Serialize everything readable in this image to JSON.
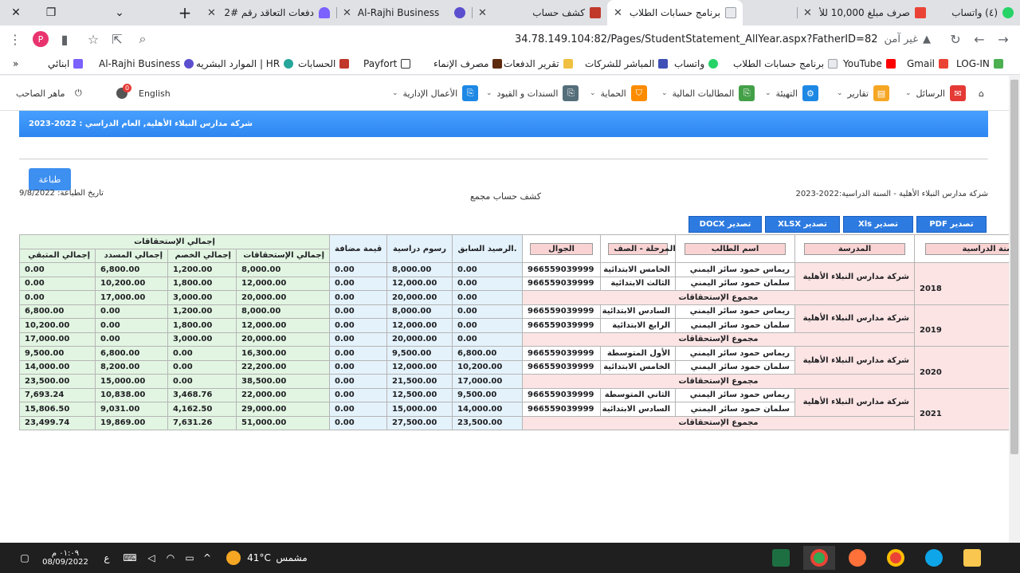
{
  "browser": {
    "tabs": [
      {
        "title": "(٤) واتساب",
        "color": "#25d366"
      },
      {
        "title": "صرف مبلغ 10,000 للأسـ",
        "color": "#ea4335"
      },
      {
        "title": "برنامج حسابات الطلاب",
        "color": "#ffffff"
      },
      {
        "title": "كشف حساب",
        "color": "#c0392b"
      },
      {
        "title": "Al-Rajhi Business",
        "color": "#5b4fcf"
      },
      {
        "title": "دفعات التعاقد رقم #2",
        "color": "#7b61ff"
      }
    ],
    "new_tab": "+",
    "url": "34.78.149.104:82/Pages/StudentStatement_AllYear.aspx?FatherID=82",
    "security_text": "غير آمن",
    "bookmarks": [
      "LOG-IN",
      "Gmail",
      "YouTube",
      "برنامج حسابات الطلاب",
      "واتساب",
      "المباشر للشركات",
      "تقرير الدفعات",
      "مصرف الإنماء",
      "Payfort",
      "الحسابات",
      "الموارد البشريه | HR",
      "Al-Rajhi Business",
      "ابنائي"
    ],
    "bookmarks_more": "»"
  },
  "nav": {
    "items": [
      "الرسائل",
      "تقارير",
      "التهيئة",
      "المطالبات المالية",
      "الحماية",
      "السندات و القيود",
      "الأعمال الإدارية"
    ],
    "language": "English",
    "user": "ماهر الصاحب",
    "notif_count": "0",
    "icon_colors": [
      "#e53935",
      "#f5a623",
      "#1e88e5",
      "#43a047",
      "#fb8c00",
      "#546e7a",
      "#1e88e5"
    ]
  },
  "page": {
    "banner": "شركة مدارس النبلاء الأهلية, العام الدراسي : 2022-2023",
    "print_button": "طباعة",
    "school_year": "شركة مدارس النبلاء الأهلية - السنة الدراسية:2022-2023",
    "statement_title": "كشف حساب مجمع",
    "print_date": "تاريخ الطباعة: 9/8/2022",
    "export_buttons": [
      "تصدير PDF",
      "تصدير Xls",
      "تصدير XLSX",
      "تصدير DOCX"
    ]
  },
  "table": {
    "headers": {
      "year": "السنة الدراسية",
      "school": "المدرسة",
      "student": "اسم الطالب",
      "stage": "المرحلة - الصف",
      "mobile": "الجوال",
      "prev_balance": "الرصيد السابق.",
      "fees": "رسوم دراسية",
      "added": "قيمة مضافة",
      "group": "إجمالي الإستحقاقات",
      "total_due": "إجمالي الإستحقاقات",
      "total_discount": "إجمالي الخصم",
      "total_paid": "إجمالي المسدد",
      "total_remaining": "إجمالي المتبقي"
    },
    "sum_label": "مجموع الإستحقاقات",
    "years": [
      {
        "year": "2018",
        "school": "شركة مدارس النبلاء الأهلية",
        "rows": [
          {
            "student": "ريماس حمود سائر اليمني",
            "stage": "الخامس الابتدائية",
            "mobile": "966559039999",
            "prev": "0.00",
            "fees": "8,000.00",
            "added": "0.00",
            "due": "8,000.00",
            "disc": "1,200.00",
            "paid": "6,800.00",
            "rem": "0.00"
          },
          {
            "student": "سلمان حمود سائر اليمني",
            "stage": "الثالث الابتدائية",
            "mobile": "966559039999",
            "prev": "0.00",
            "fees": "12,000.00",
            "added": "0.00",
            "due": "12,000.00",
            "disc": "1,800.00",
            "paid": "10,200.00",
            "rem": "0.00"
          }
        ],
        "sum": {
          "prev": "0.00",
          "fees": "20,000.00",
          "added": "0.00",
          "due": "20,000.00",
          "disc": "3,000.00",
          "paid": "17,000.00",
          "rem": "0.00"
        }
      },
      {
        "year": "2019",
        "school": "شركة مدارس النبلاء الأهلية",
        "rows": [
          {
            "student": "ريماس حمود سائر اليمني",
            "stage": "السادس الابتدائية",
            "mobile": "966559039999",
            "prev": "0.00",
            "fees": "8,000.00",
            "added": "0.00",
            "due": "8,000.00",
            "disc": "1,200.00",
            "paid": "0.00",
            "rem": "6,800.00"
          },
          {
            "student": "سلمان حمود سائر اليمني",
            "stage": "الرابع الابتدائية",
            "mobile": "966559039999",
            "prev": "0.00",
            "fees": "12,000.00",
            "added": "0.00",
            "due": "12,000.00",
            "disc": "1,800.00",
            "paid": "0.00",
            "rem": "10,200.00"
          }
        ],
        "sum": {
          "prev": "0.00",
          "fees": "20,000.00",
          "added": "0.00",
          "due": "20,000.00",
          "disc": "3,000.00",
          "paid": "0.00",
          "rem": "17,000.00"
        }
      },
      {
        "year": "2020",
        "school": "شركة مدارس النبلاء الأهلية",
        "rows": [
          {
            "student": "ريماس حمود سائر اليمني",
            "stage": "الأول المتوسطة",
            "mobile": "966559039999",
            "prev": "6,800.00",
            "fees": "9,500.00",
            "added": "0.00",
            "due": "16,300.00",
            "disc": "0.00",
            "paid": "6,800.00",
            "rem": "9,500.00"
          },
          {
            "student": "سلمان حمود سائر اليمني",
            "stage": "الخامس الابتدائية",
            "mobile": "966559039999",
            "prev": "10,200.00",
            "fees": "12,000.00",
            "added": "0.00",
            "due": "22,200.00",
            "disc": "0.00",
            "paid": "8,200.00",
            "rem": "14,000.00"
          }
        ],
        "sum": {
          "prev": "17,000.00",
          "fees": "21,500.00",
          "added": "0.00",
          "due": "38,500.00",
          "disc": "0.00",
          "paid": "15,000.00",
          "rem": "23,500.00"
        }
      },
      {
        "year": "2021",
        "school": "شركة مدارس النبلاء الأهلية",
        "rows": [
          {
            "student": "ريماس حمود سائر اليمني",
            "stage": "الثاني المتوسطة",
            "mobile": "966559039999",
            "prev": "9,500.00",
            "fees": "12,500.00",
            "added": "0.00",
            "due": "22,000.00",
            "disc": "3,468.76",
            "paid": "10,838.00",
            "rem": "7,693.24"
          },
          {
            "student": "سلمان حمود سائر اليمني",
            "stage": "السادس الابتدائية",
            "mobile": "966559039999",
            "prev": "14,000.00",
            "fees": "15,000.00",
            "added": "0.00",
            "due": "29,000.00",
            "disc": "4,162.50",
            "paid": "9,031.00",
            "rem": "15,806.50"
          }
        ],
        "sum": {
          "prev": "23,500.00",
          "fees": "27,500.00",
          "added": "0.00",
          "due": "51,000.00",
          "disc": "7,631.26",
          "paid": "19,869.00",
          "rem": "23,499.74"
        }
      }
    ]
  },
  "taskbar": {
    "time": "٠١:٠٩ م",
    "date": "08/09/2022",
    "lang": "ع",
    "temp": "41°C",
    "weather": "مشمس"
  }
}
